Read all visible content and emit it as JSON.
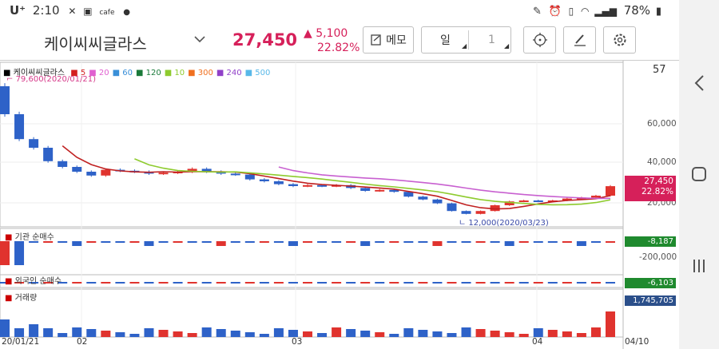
{
  "status_bar": {
    "carrier": "U⁺",
    "time": "2:10",
    "app_label": "cafe",
    "battery": "78%"
  },
  "header": {
    "stock_name": "케이씨씨글라스",
    "price": "27,450",
    "change": "▲ 5,100",
    "change_pct": "22.82%",
    "memo_label": "메모",
    "period_label": "일",
    "period_count": "1"
  },
  "chart": {
    "legend_name": "케이씨씨글라스",
    "ma_legend": [
      {
        "label": "5",
        "color": "#d32020"
      },
      {
        "label": "20",
        "color": "#e060d0"
      },
      {
        "label": "60",
        "color": "#3a8fd8"
      },
      {
        "label": "120",
        "color": "#1a7a3a"
      },
      {
        "label": "10",
        "color": "#8ecb2e"
      },
      {
        "label": "300",
        "color": "#f07020"
      },
      {
        "label": "240",
        "color": "#9040c8"
      },
      {
        "label": "500",
        "color": "#58b8e8"
      }
    ],
    "top_right_value": "57",
    "high_annotation": "79,600(2020/01/21)",
    "low_annotation": "12,000(2020/03/23)",
    "y_axis": [
      "60,000",
      "40,000",
      "20,000",
      "-200,000"
    ],
    "price_tag": "27,450",
    "price_tag_pct": "22.82%",
    "inst_title": "기관 순매수",
    "inst_value": "-8,187",
    "foreign_title": "외국인 순매수",
    "foreign_value": "-6,103",
    "volume_title": "거래량",
    "volume_value": "1,745,705",
    "x_axis": [
      "20/01/21",
      "02",
      "03",
      "04",
      "04/10"
    ],
    "colors": {
      "up": "#e0332e",
      "down": "#2e62c8",
      "accent": "#d6205a"
    }
  },
  "chart_data": {
    "type": "candlestick",
    "title": "케이씨씨글라스",
    "x_start": "20/01/21",
    "x_end": "04/10",
    "y_ticks": [
      20000,
      40000,
      60000
    ],
    "high": {
      "value": 79600,
      "date": "2020/01/21"
    },
    "low": {
      "value": 12000,
      "date": "2020/03/23"
    },
    "last_close": 27450,
    "close_series": [
      65000,
      52000,
      47500,
      40500,
      37500,
      35000,
      33000,
      36000,
      35500,
      35000,
      34000,
      34500,
      35000,
      36500,
      35000,
      34000,
      33500,
      31000,
      30000,
      28500,
      27500,
      28000,
      27500,
      28000,
      26500,
      25000,
      25500,
      24500,
      22000,
      20500,
      18500,
      14500,
      13000,
      14500,
      17500,
      19500,
      20000,
      19500,
      20000,
      21000,
      21500,
      22500,
      27450
    ]
  }
}
